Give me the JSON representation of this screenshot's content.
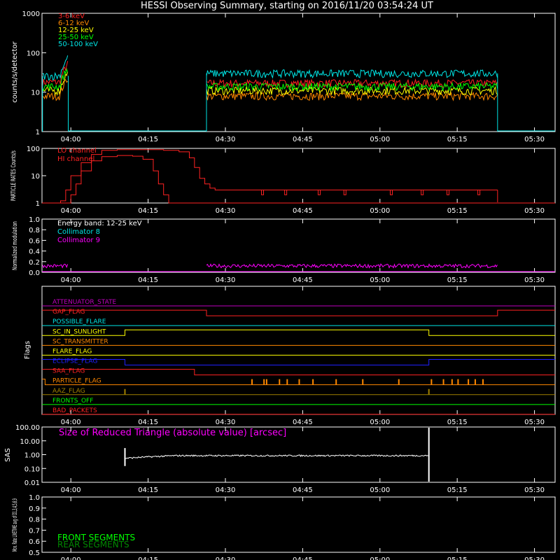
{
  "title": "HESSI Observing Summary, starting on 2016/11/20 03:54:24 UT",
  "time_axis": {
    "start": "03:54:24",
    "end": "05:34:00",
    "ticks": [
      "04:00",
      "04:15",
      "04:30",
      "04:45",
      "05:00",
      "05:15",
      "05:30"
    ]
  },
  "chart_data": [
    {
      "type": "line",
      "panel": "count_rates",
      "ylabel": "counts/s/detector",
      "yscale": "log",
      "ylim": [
        1,
        1000
      ],
      "yticks": [
        "1",
        "10",
        "100",
        "1000"
      ],
      "grid": false,
      "legend_placement": "top-left",
      "series": [
        {
          "name": "3-6 keV",
          "color": "#ff2222",
          "segments": [
            {
              "from": "03:54:30",
              "to": "03:59:30",
              "level": 18
            },
            {
              "from": "04:26:20",
              "to": "05:22:50",
              "level": 17
            }
          ]
        },
        {
          "name": "6-12 keV",
          "color": "#ff8800",
          "segments": [
            {
              "from": "03:54:30",
              "to": "03:59:30",
              "level": 8
            },
            {
              "from": "04:26:20",
              "to": "05:22:50",
              "level": 8
            }
          ]
        },
        {
          "name": "12-25 keV",
          "color": "#ffff00",
          "segments": [
            {
              "from": "03:54:30",
              "to": "03:59:30",
              "level": 11
            },
            {
              "from": "04:26:20",
              "to": "05:22:50",
              "level": 11
            }
          ]
        },
        {
          "name": "25-50 keV",
          "color": "#00ff00",
          "segments": [
            {
              "from": "03:54:30",
              "to": "03:59:30",
              "level": 14
            },
            {
              "from": "04:26:20",
              "to": "05:22:50",
              "level": 14
            }
          ]
        },
        {
          "name": "50-100 keV",
          "color": "#00e5e5",
          "segments": [
            {
              "from": "03:54:30",
              "to": "03:59:30",
              "level": 26
            },
            {
              "from": "04:26:20",
              "to": "05:22:50",
              "level": 30
            }
          ]
        }
      ]
    },
    {
      "type": "line",
      "panel": "particle_rates",
      "ylabel": "PARTICLE RATES Counts/s",
      "yscale": "log",
      "ylim": [
        1,
        100
      ],
      "yticks": [
        "1",
        "10",
        "100"
      ],
      "legend_placement": "top-left",
      "series": [
        {
          "name": "LO channel",
          "color": "#ff2222",
          "x": [
            "03:54:24",
            "03:58:00",
            "03:59:00",
            "04:00:00",
            "04:02:00",
            "04:04:00",
            "04:06:00",
            "04:09:00",
            "04:14:00",
            "04:18:00",
            "04:21:00",
            "04:23:00",
            "04:24:00",
            "04:25:00",
            "04:26:00",
            "04:27:00",
            "04:28:00",
            "04:30:00",
            "05:22:50"
          ],
          "y": [
            1,
            1.2,
            3,
            10,
            30,
            60,
            85,
            90,
            90,
            85,
            75,
            45,
            20,
            8,
            5,
            3.5,
            3,
            3,
            3
          ]
        },
        {
          "name": "HI channel",
          "color": "#ff2222",
          "x": [
            "03:54:24",
            "03:59:00",
            "04:00:00",
            "04:01:00",
            "04:02:00",
            "04:04:00",
            "04:06:00",
            "04:09:00",
            "04:12:00",
            "04:14:00",
            "04:16:00",
            "04:17:00",
            "04:18:00",
            "04:19:00",
            "05:34:00"
          ],
          "y": [
            1,
            1,
            2,
            5,
            15,
            35,
            50,
            55,
            52,
            40,
            15,
            5,
            2,
            1,
            1
          ]
        }
      ]
    },
    {
      "type": "line",
      "panel": "modulation",
      "ylabel": "Normalized modulation",
      "ylim": [
        0,
        1
      ],
      "yticks": [
        "0.0",
        "0.2",
        "0.4",
        "0.6",
        "0.8",
        "1.0"
      ],
      "annotation": "Energy band: 12-25 keV",
      "legend_placement": "top-left",
      "series": [
        {
          "name": "Collimator 8",
          "color": "#00e5e5",
          "level": 0.11
        },
        {
          "name": "Collimator 9",
          "color": "#ff00ff",
          "level": 0.12,
          "segments": [
            {
              "from": "03:54:30",
              "to": "03:59:30"
            },
            {
              "from": "04:26:20",
              "to": "05:22:50"
            }
          ]
        }
      ]
    },
    {
      "type": "line",
      "panel": "flags",
      "ylabel": "Flags",
      "series": [
        {
          "name": "ATTENUATOR_STATE",
          "color": "#c000c0",
          "steps": [
            {
              "from": "03:54:24",
              "to": "05:34:00",
              "on": false
            }
          ]
        },
        {
          "name": "GAP_FLAG",
          "color": "#ff2222",
          "steps": [
            {
              "from": "03:54:24",
              "to": "04:26:20",
              "on": true
            },
            {
              "from": "04:26:20",
              "to": "05:22:50",
              "on": false
            },
            {
              "from": "05:22:50",
              "to": "05:34:00",
              "on": true
            }
          ]
        },
        {
          "name": "POSSIBLE_FLARE",
          "color": "#00e5e5",
          "steps": [
            {
              "from": "03:54:24",
              "to": "05:34:00",
              "on": false
            }
          ]
        },
        {
          "name": "SC_IN_SUNLIGHT",
          "color": "#ffff00",
          "steps": [
            {
              "from": "03:54:24",
              "to": "04:10:30",
              "on": false
            },
            {
              "from": "04:10:30",
              "to": "05:09:30",
              "on": true
            },
            {
              "from": "05:09:30",
              "to": "05:34:00",
              "on": false
            }
          ]
        },
        {
          "name": "SC_TRANSMITTER",
          "color": "#ff8800",
          "steps": [
            {
              "from": "03:54:24",
              "to": "05:34:00",
              "on": false
            }
          ]
        },
        {
          "name": "FLARE_FLAG",
          "color": "#ffff00",
          "steps": [
            {
              "from": "03:54:24",
              "to": "05:34:00",
              "on": false
            }
          ]
        },
        {
          "name": "ECLIPSE_FLAG",
          "color": "#2020ff",
          "steps": [
            {
              "from": "03:54:24",
              "to": "04:10:30",
              "on": true
            },
            {
              "from": "04:10:30",
              "to": "05:09:30",
              "on": false
            },
            {
              "from": "05:09:30",
              "to": "05:34:00",
              "on": true
            }
          ]
        },
        {
          "name": "SAA_FLAG",
          "color": "#ff2222",
          "steps": [
            {
              "from": "03:54:24",
              "to": "04:24:00",
              "on": true
            },
            {
              "from": "04:24:00",
              "to": "05:34:00",
              "on": false
            }
          ]
        },
        {
          "name": "PARTICLE_FLAG",
          "color": "#ff8800",
          "steps": [
            {
              "from": "03:54:24",
              "to": "03:55:00",
              "on": true
            },
            {
              "from": "03:55:00",
              "to": "05:34:00",
              "on": false
            }
          ],
          "spikes": [
            "04:35:10",
            "04:37:30",
            "04:38:00",
            "04:40:30",
            "04:42:00",
            "04:44:20",
            "04:47:00",
            "04:51:30",
            "04:56:40",
            "05:03:40",
            "05:10:00",
            "05:12:20",
            "05:14:00",
            "05:15:10",
            "05:17:10",
            "05:18:30",
            "05:20:00"
          ]
        },
        {
          "name": "AAZ_FLAG",
          "color": "#a08000",
          "steps": [
            {
              "from": "03:54:24",
              "to": "05:34:00",
              "on": false
            }
          ],
          "spikes": [
            "04:10:30",
            "05:09:30"
          ]
        },
        {
          "name": "FRONTS_OFF",
          "color": "#00ff00",
          "steps": [
            {
              "from": "03:54:24",
              "to": "05:34:00",
              "on": false
            }
          ]
        },
        {
          "name": "BAD_PACKETS",
          "color": "#ff2222",
          "steps": [
            {
              "from": "03:54:24",
              "to": "05:34:00",
              "on": false
            }
          ]
        }
      ]
    },
    {
      "type": "line",
      "panel": "sas",
      "ylabel": "SAS",
      "yscale": "log",
      "ylim": [
        0.01,
        100
      ],
      "yticks": [
        "0.01",
        "0.10",
        "1.00",
        "10.00",
        "100.00"
      ],
      "annotation": "Size of Reduced Triangle (absolute value) [arcsec]",
      "series": [
        {
          "name": "",
          "color": "#ffffff",
          "from": "04:10:30",
          "to": "05:09:30",
          "level_start": 0.55,
          "level_end": 0.85
        }
      ]
    },
    {
      "type": "line",
      "panel": "livetime",
      "ylabel": "Mon. Rate LIVETIME avg of D1,3,4,5,6,9",
      "ylim": [
        0.5,
        1
      ],
      "yticks": [
        "0.5",
        "0.6",
        "0.7",
        "0.8",
        "0.9",
        "1.0"
      ],
      "series": [
        {
          "name": "FRONT SEGMENTS",
          "color": "#00ff00"
        },
        {
          "name": "REAR SEGMENTS",
          "color": "#008800"
        }
      ]
    }
  ]
}
